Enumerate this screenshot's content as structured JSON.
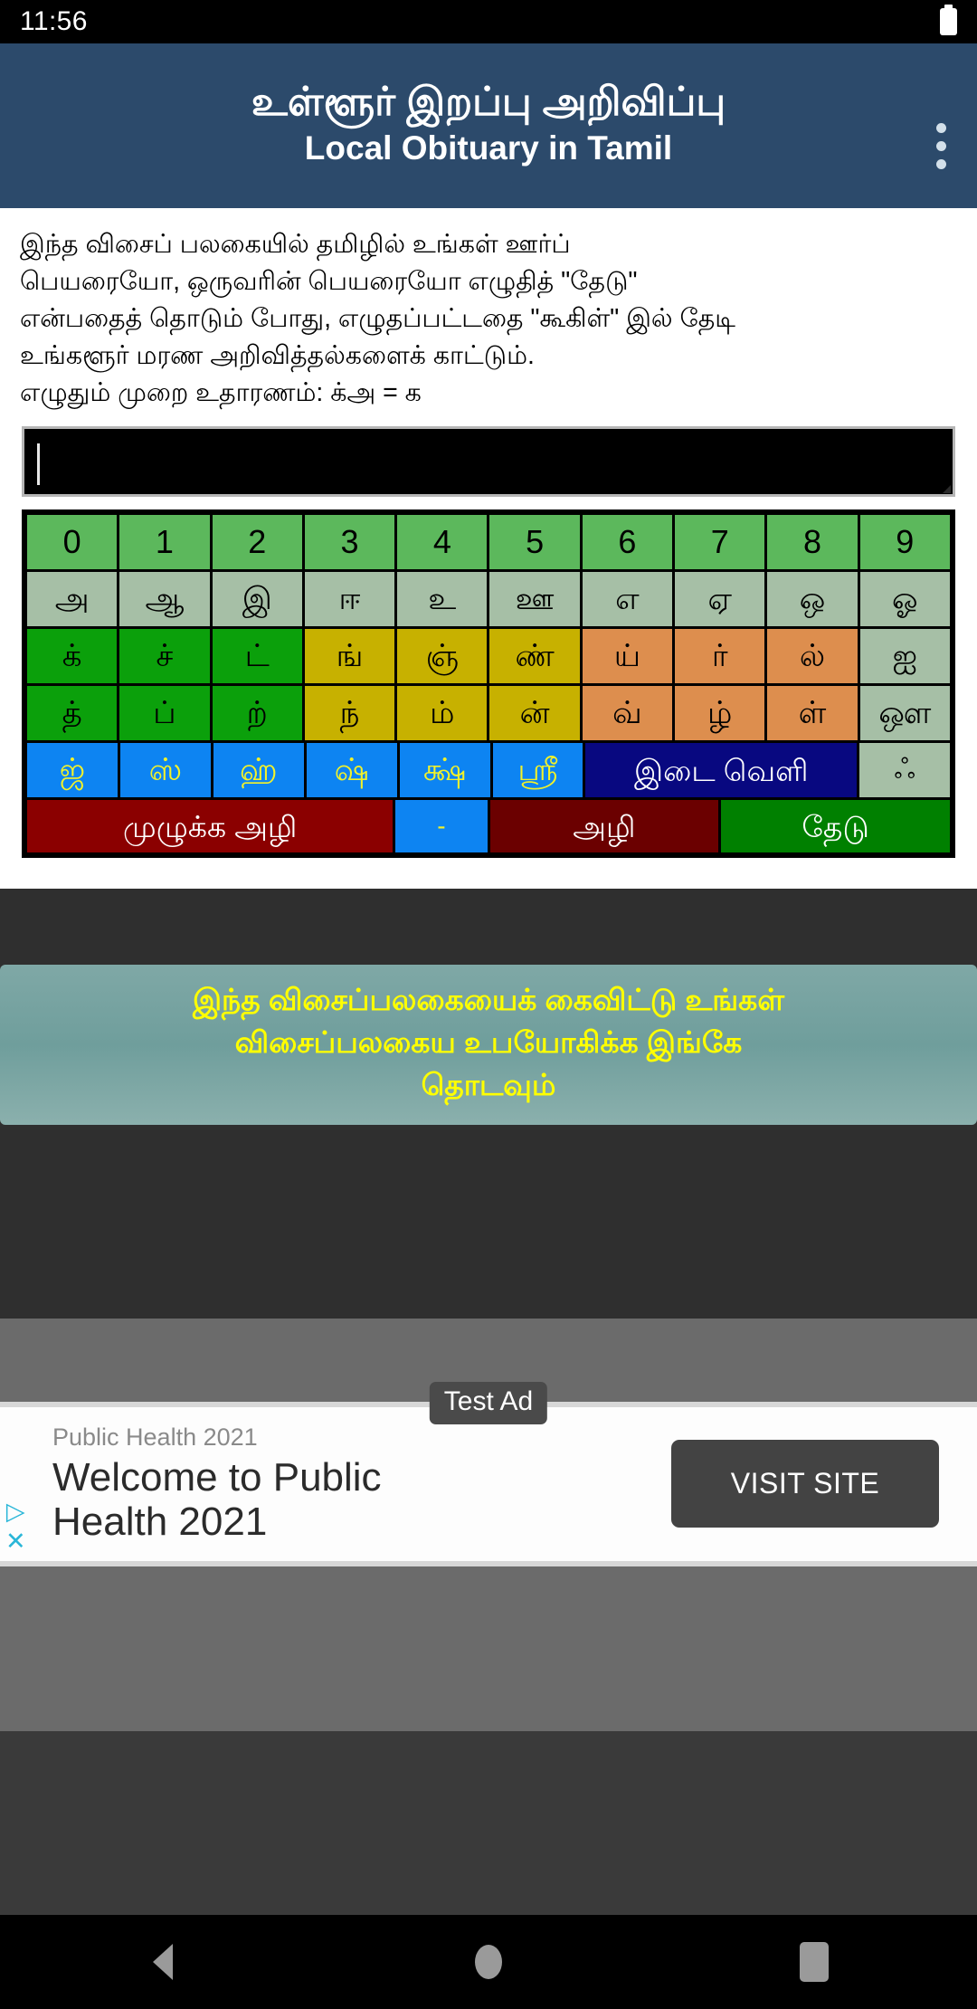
{
  "status_bar": {
    "time": "11:56",
    "battery_icon": "battery-full-icon"
  },
  "app_bar": {
    "title_tamil": "உள்ளூர் இறப்பு அறிவிப்பு",
    "title_english": "Local Obituary in Tamil",
    "overflow_icon": "overflow-menu-icon"
  },
  "instructions": {
    "line1": "இந்த விசைப் பலகையில் தமிழில் உங்கள் ஊர்ப்",
    "line2": "பெயரையோ, ஒருவரின் பெயரையோ எழுதித் \"தேடு\"",
    "line3": "என்பதைத் தொடும் போது, எழுதப்பட்டதை \"கூகிள்\" இல் தேடி",
    "line4": "உங்களூர் மரண அறிவித்தல்களைக் காட்டும்.",
    "line5": "எழுதும் முறை உதாரணம்: க்அ = க"
  },
  "search_input": {
    "value": "",
    "placeholder": ""
  },
  "keyboard": {
    "rows": [
      {
        "name": "numbers",
        "keys": [
          {
            "label": "0",
            "style": "num"
          },
          {
            "label": "1",
            "style": "num"
          },
          {
            "label": "2",
            "style": "num"
          },
          {
            "label": "3",
            "style": "num"
          },
          {
            "label": "4",
            "style": "num"
          },
          {
            "label": "5",
            "style": "num"
          },
          {
            "label": "6",
            "style": "num"
          },
          {
            "label": "7",
            "style": "num"
          },
          {
            "label": "8",
            "style": "num"
          },
          {
            "label": "9",
            "style": "num"
          }
        ]
      },
      {
        "name": "vowels",
        "keys": [
          {
            "label": "அ",
            "style": "sage"
          },
          {
            "label": "ஆ",
            "style": "sage"
          },
          {
            "label": "இ",
            "style": "sage"
          },
          {
            "label": "ஈ",
            "style": "sage"
          },
          {
            "label": "உ",
            "style": "sage"
          },
          {
            "label": "ஊ",
            "style": "sage"
          },
          {
            "label": "எ",
            "style": "sage"
          },
          {
            "label": "ஏ",
            "style": "sage"
          },
          {
            "label": "ஒ",
            "style": "sage"
          },
          {
            "label": "ஓ",
            "style": "sage"
          }
        ]
      },
      {
        "name": "consonants-1",
        "keys": [
          {
            "label": "க்",
            "style": "green"
          },
          {
            "label": "ச்",
            "style": "green"
          },
          {
            "label": "ட்",
            "style": "green"
          },
          {
            "label": "ங்",
            "style": "olive"
          },
          {
            "label": "ஞ்",
            "style": "olive"
          },
          {
            "label": "ண்",
            "style": "olive"
          },
          {
            "label": "ய்",
            "style": "orange"
          },
          {
            "label": "ர்",
            "style": "orange"
          },
          {
            "label": "ல்",
            "style": "orange"
          },
          {
            "label": "ஐ",
            "style": "sage"
          }
        ]
      },
      {
        "name": "consonants-2",
        "keys": [
          {
            "label": "த்",
            "style": "green"
          },
          {
            "label": "ப்",
            "style": "green"
          },
          {
            "label": "ற்",
            "style": "green"
          },
          {
            "label": "ந்",
            "style": "olive"
          },
          {
            "label": "ம்",
            "style": "olive"
          },
          {
            "label": "ன்",
            "style": "olive"
          },
          {
            "label": "வ்",
            "style": "orange"
          },
          {
            "label": "ழ்",
            "style": "orange"
          },
          {
            "label": "ள்",
            "style": "orange"
          },
          {
            "label": "ஔ",
            "style": "sage"
          }
        ]
      },
      {
        "name": "grantha-and-space",
        "keys": [
          {
            "label": "ஜ்",
            "style": "blue",
            "span": 1
          },
          {
            "label": "ஸ்",
            "style": "blue",
            "span": 1
          },
          {
            "label": "ஹ்",
            "style": "blue",
            "span": 1
          },
          {
            "label": "ஷ்",
            "style": "blue",
            "span": 1
          },
          {
            "label": "க்ஷ்",
            "style": "blue",
            "span": 1
          },
          {
            "label": "ஸ்ரீ",
            "style": "blue",
            "span": 1
          },
          {
            "label": "இடை வெளி",
            "style": "navy",
            "span": 3
          },
          {
            "label": "ஃ",
            "style": "aytham",
            "span": 1
          }
        ]
      },
      {
        "name": "actions",
        "keys": [
          {
            "label": "முழுக்க அழி",
            "style": "darkred",
            "span": 4
          },
          {
            "label": "-",
            "style": "dash",
            "span": 1
          },
          {
            "label": "அழி",
            "style": "darkred2",
            "span": 2.5
          },
          {
            "label": "தேடு",
            "style": "go",
            "span": 2.5
          }
        ]
      }
    ]
  },
  "switch_keyboard_banner": {
    "line1": "இந்த விசைப்பலகையைக் கைவிட்டு உங்கள்",
    "line2": "விசைப்பலகைய உபயோகிக்க இங்கே",
    "line3": "தொடவும்"
  },
  "ad": {
    "badge": "Test Ad",
    "advertiser": "Public Health 2021",
    "headline_line1": "Welcome to Public",
    "headline_line2": "Health 2021",
    "cta": "VISIT SITE",
    "adchoices_icon": "adchoices-icon",
    "close_icon": "close-icon"
  },
  "nav_bar": {
    "back": "back-icon",
    "home": "home-icon",
    "recents": "recents-icon"
  },
  "colors": {
    "app_bar": "#2c4a6b",
    "key_number": "#5cb85c",
    "key_sage": "#a6bfa6",
    "key_green": "#0ba00b",
    "key_olive": "#c7b100",
    "key_orange": "#dd8e4e",
    "key_blue": "#0d84f2",
    "key_navy": "#080880",
    "key_darkred": "#8b0000",
    "key_search": "#008000",
    "banner_text": "#ffff00",
    "background_dark": "#2f2f2f"
  }
}
